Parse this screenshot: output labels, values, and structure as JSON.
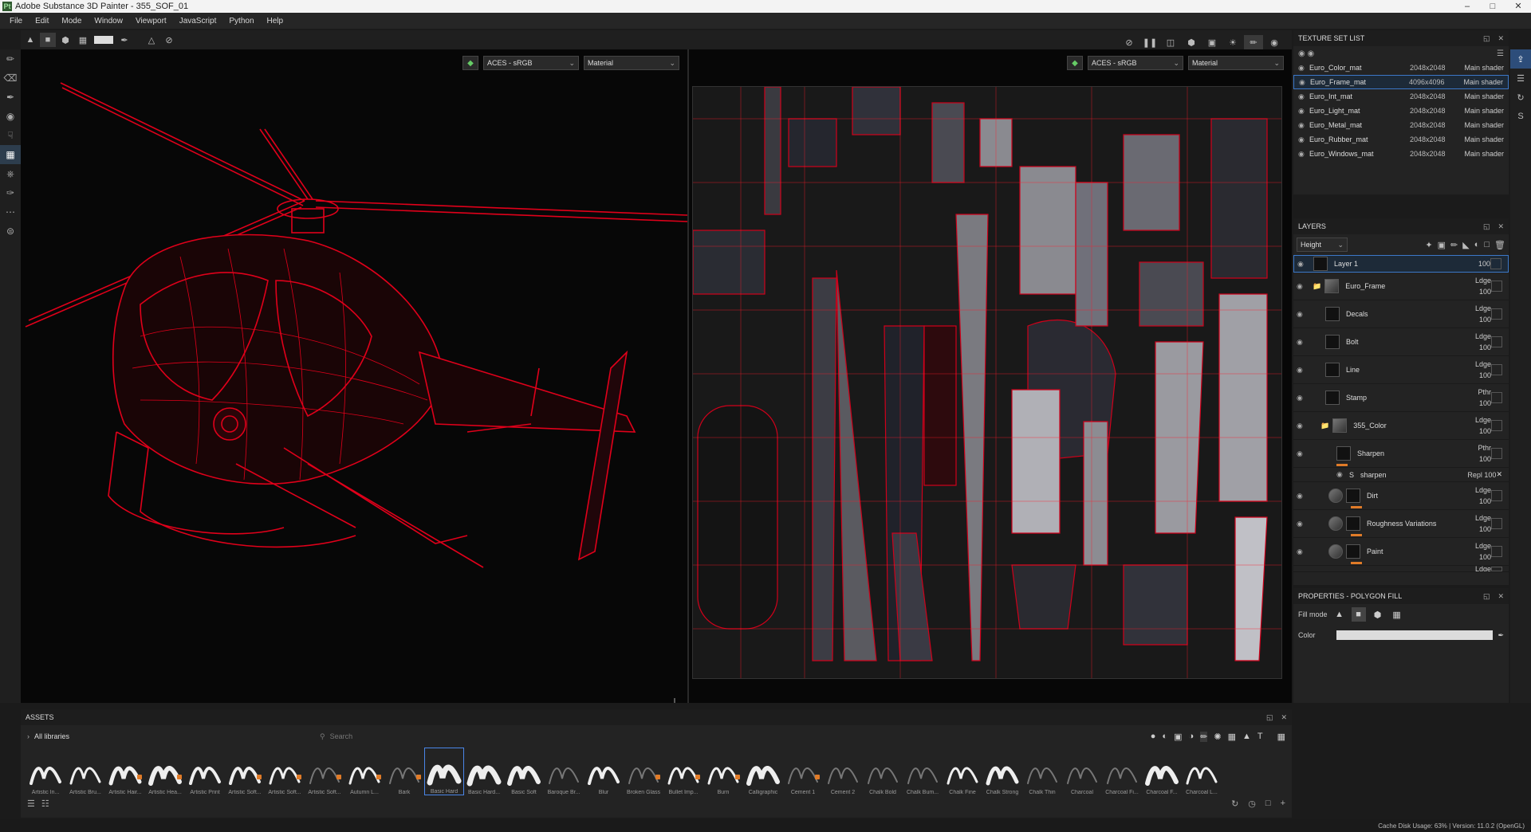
{
  "window": {
    "title": "Adobe Substance 3D Painter - 355_SOF_01",
    "app_icon": "Pt"
  },
  "menu": [
    "File",
    "Edit",
    "Mode",
    "Window",
    "Viewport",
    "JavaScript",
    "Python",
    "Help"
  ],
  "viewport3d": {
    "colorspace": "ACES - sRGB",
    "mode": "Material"
  },
  "viewport2d": {
    "colorspace": "ACES - sRGB",
    "mode": "Material"
  },
  "texture_set_list": {
    "title": "TEXTURE SET LIST",
    "items": [
      {
        "name": "Euro_Color_mat",
        "size": "2048x2048",
        "shader": "Main shader"
      },
      {
        "name": "Euro_Frame_mat",
        "size": "4096x4096",
        "shader": "Main shader",
        "selected": true
      },
      {
        "name": "Euro_Int_mat",
        "size": "2048x2048",
        "shader": "Main shader"
      },
      {
        "name": "Euro_Light_mat",
        "size": "2048x2048",
        "shader": "Main shader"
      },
      {
        "name": "Euro_Metal_mat",
        "size": "2048x2048",
        "shader": "Main shader"
      },
      {
        "name": "Euro_Rubber_mat",
        "size": "2048x2048",
        "shader": "Main shader"
      },
      {
        "name": "Euro_Windows_mat",
        "size": "2048x2048",
        "shader": "Main shader"
      }
    ]
  },
  "layers": {
    "title": "LAYERS",
    "channel": "Height",
    "items": [
      {
        "name": "Layer 1",
        "blend": "",
        "opacity": "100"
      },
      {
        "name": "Euro_Frame",
        "blend": "Ldge",
        "opacity": "100"
      },
      {
        "name": "Decals",
        "blend": "Ldge",
        "opacity": "100"
      },
      {
        "name": "Bolt",
        "blend": "Ldge",
        "opacity": "100"
      },
      {
        "name": "Line",
        "blend": "Ldge",
        "opacity": "100"
      },
      {
        "name": "Stamp",
        "blend": "Pthr",
        "opacity": "100"
      },
      {
        "name": "355_Color",
        "blend": "Ldge",
        "opacity": "100"
      },
      {
        "name": "Sharpen",
        "blend": "Pthr",
        "opacity": "100"
      },
      {
        "name": "sharpen",
        "blend": "Repl",
        "opacity": "100"
      },
      {
        "name": "Dirt",
        "blend": "Ldge",
        "opacity": "100"
      },
      {
        "name": "Roughness Variations",
        "blend": "Ldge",
        "opacity": "100"
      },
      {
        "name": "Paint",
        "blend": "Ldge",
        "opacity": "100"
      }
    ],
    "partial_blend": "Ldge"
  },
  "properties": {
    "title": "PROPERTIES - POLYGON FILL",
    "fill_mode_label": "Fill mode",
    "color_label": "Color",
    "color_value": "#dcdcdc"
  },
  "assets": {
    "title": "ASSETS",
    "library": "All libraries",
    "search_placeholder": "Search",
    "brushes": [
      "Artistic In...",
      "Artistic Bru...",
      "Artistic Hair...",
      "Artistic Hea...",
      "Artistic Print",
      "Artistic Soft...",
      "Artistic Soft...",
      "Artistic Soft...",
      "Autumn L...",
      "Bark",
      "Basic Hard",
      "Basic Hard...",
      "Basic Soft",
      "Baroque Br...",
      "Blur",
      "Broken Glass",
      "Bullet Imp...",
      "Burn",
      "Calligraphic",
      "Cement 1",
      "Cement 2",
      "Chalk Bold",
      "Chalk Bum...",
      "Chalk Fine",
      "Chalk Strong",
      "Chalk Thin",
      "Charcoal",
      "Charcoal Fi...",
      "Charcoal F...",
      "Charcoal L..."
    ]
  },
  "status": "Cache Disk Usage:   63%  |  Version: 11.0.2 (OpenGL)",
  "colors": {
    "accent": "#3c78c8",
    "wire": "#e0001a",
    "orange": "#e07b28"
  }
}
